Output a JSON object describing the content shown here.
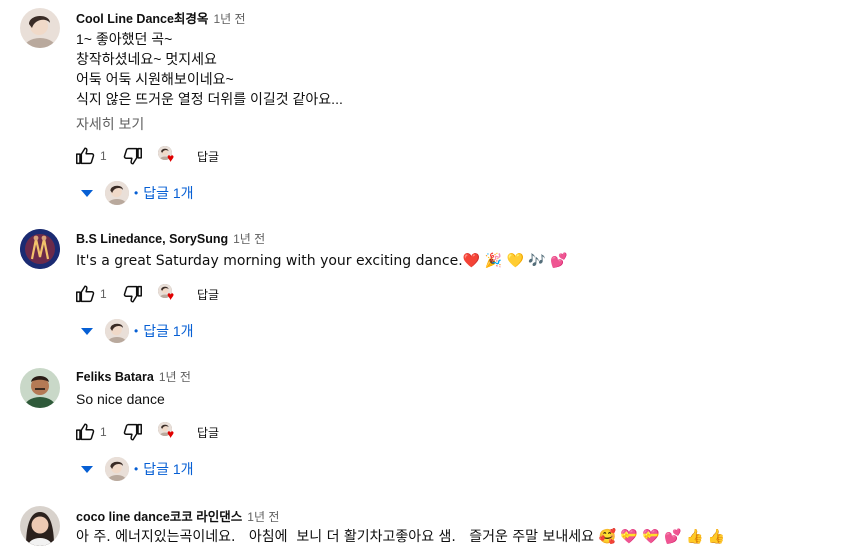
{
  "colors": {
    "link": "#065fd4",
    "muted": "#606060",
    "heart": "#e00000"
  },
  "icons": {
    "like": "thumb-up-icon",
    "dislike": "thumb-down-icon",
    "expand": "triangle-down-icon",
    "hearted": "creator-heart-icon"
  },
  "comments": [
    {
      "author": "Cool Line Dance최경옥",
      "time": "1년 전",
      "lines": [
        "1~ 좋아했던 곡~",
        "창작하셨네요~ 멋지세요",
        "어둑 어둑 시원해보이네요~",
        "식지 않은 뜨거운 열정 더위를 이길것 같아요..."
      ],
      "more": "자세히 보기",
      "likes": "1",
      "reply": "답글",
      "replies_dot": "•",
      "replies": "답글 1개"
    },
    {
      "author": "B.S Linedance, SorySung",
      "time": "1년 전",
      "lines": [
        "It's a great Saturday morning with your exciting dance.❤️ 🎉 💛 🎶 💕"
      ],
      "likes": "1",
      "reply": "답글",
      "replies_dot": "•",
      "replies": "답글 1개"
    },
    {
      "author": "Feliks Batara",
      "time": "1년 전",
      "lines": [
        "So nice dance"
      ],
      "likes": "1",
      "reply": "답글",
      "replies_dot": "•",
      "replies": "답글 1개"
    },
    {
      "author": "coco line dance코코 라인댄스",
      "time": "1년 전",
      "lines": [
        "아 주. 에너지있는곡이네요.   아침에  보니 더 활기차고좋아요 샘.   즐거운 주말 보내세요 🥰 💝 💝 💕 👍 👍"
      ]
    }
  ]
}
